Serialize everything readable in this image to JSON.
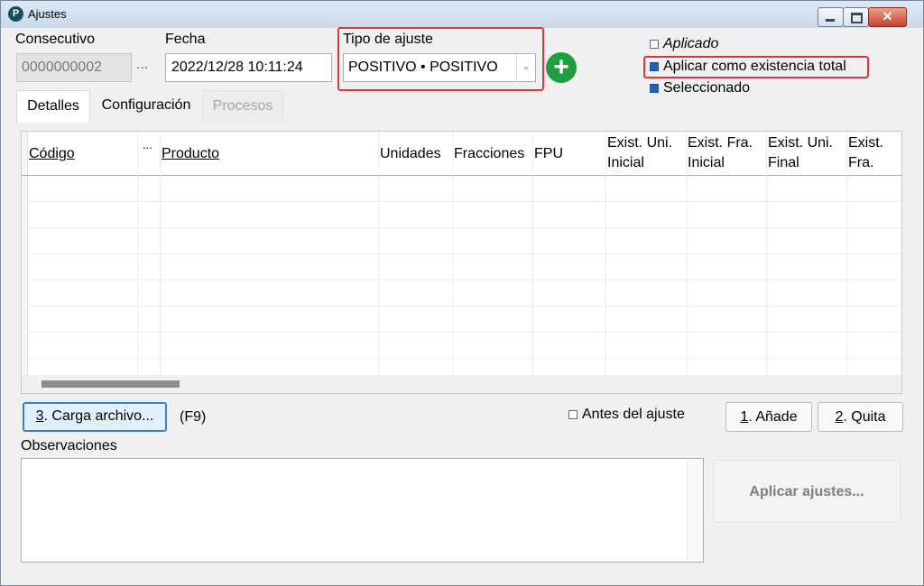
{
  "window": {
    "title": "Ajustes",
    "close_glyph": "✕"
  },
  "fields": {
    "consecutivo_label": "Consecutivo",
    "consecutivo_value": "0000000002",
    "browse_label": "...",
    "fecha_label": "Fecha",
    "fecha_value": "2022/12/28 10:11:24",
    "tipo_label": "Tipo de ajuste",
    "tipo_value": "POSITIVO • POSITIVO"
  },
  "checkboxes": [
    {
      "label": "Aplicado",
      "checked": false
    },
    {
      "label": "Aplicar como existencia total",
      "checked": true
    },
    {
      "label": "Seleccionado",
      "checked": true
    }
  ],
  "tabs": [
    {
      "label": "Detalles",
      "state": "active"
    },
    {
      "label": "Configuración",
      "state": "normal"
    },
    {
      "label": "Procesos",
      "state": "disabled"
    }
  ],
  "grid": {
    "columns": [
      {
        "label": "Código"
      },
      {
        "label": "..."
      },
      {
        "label": "Producto"
      },
      {
        "label": "Unidades"
      },
      {
        "label": "Fracciones"
      },
      {
        "label": "FPU"
      },
      {
        "label": "Exist. Uni. Inicial"
      },
      {
        "label": "Exist. Fra. Inicial"
      },
      {
        "label": "Exist. Uni. Final"
      },
      {
        "label": "Exist. Fra. Final"
      }
    ],
    "rows": []
  },
  "actions": {
    "carga_prefix": "3",
    "carga_label": ". Carga archivo...",
    "carga_shortcut": "(F9)",
    "antes_label": "Antes del ajuste",
    "add_prefix": "1",
    "add_label": ". Añade",
    "remove_prefix": "2",
    "remove_label": ". Quita",
    "observaciones_label": "Observaciones",
    "apply_label": "Aplicar ajustes..."
  },
  "colors": {
    "highlight": "#e0353b",
    "add_icon": "#1f9d3f",
    "checkbox_checked": "#1f5fbf"
  },
  "icons": {
    "add": "plus-circle-icon",
    "app_logo": "app-logo-icon"
  }
}
